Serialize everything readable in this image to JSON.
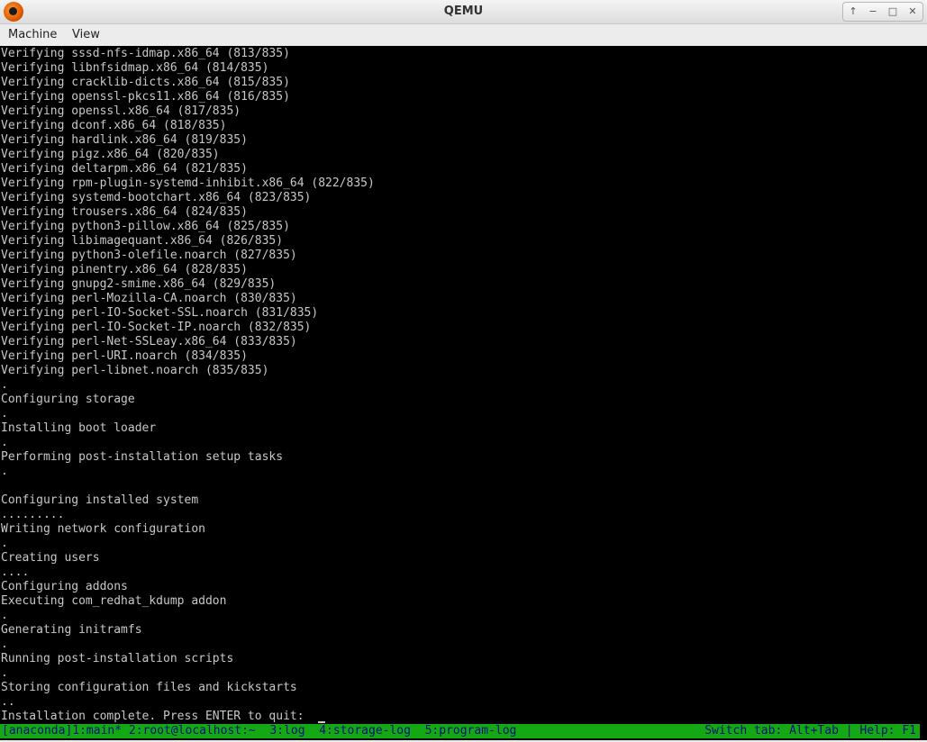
{
  "window": {
    "title": "QEMU",
    "controls": [
      "↑",
      "−",
      "□",
      "✕"
    ]
  },
  "menubar": {
    "items": [
      "Machine",
      "View"
    ]
  },
  "terminal": {
    "lines": [
      "Verifying sssd-nfs-idmap.x86_64 (813/835)",
      "Verifying libnfsidmap.x86_64 (814/835)",
      "Verifying cracklib-dicts.x86_64 (815/835)",
      "Verifying openssl-pkcs11.x86_64 (816/835)",
      "Verifying openssl.x86_64 (817/835)",
      "Verifying dconf.x86_64 (818/835)",
      "Verifying hardlink.x86_64 (819/835)",
      "Verifying pigz.x86_64 (820/835)",
      "Verifying deltarpm.x86_64 (821/835)",
      "Verifying rpm-plugin-systemd-inhibit.x86_64 (822/835)",
      "Verifying systemd-bootchart.x86_64 (823/835)",
      "Verifying trousers.x86_64 (824/835)",
      "Verifying python3-pillow.x86_64 (825/835)",
      "Verifying libimagequant.x86_64 (826/835)",
      "Verifying python3-olefile.noarch (827/835)",
      "Verifying pinentry.x86_64 (828/835)",
      "Verifying gnupg2-smime.x86_64 (829/835)",
      "Verifying perl-Mozilla-CA.noarch (830/835)",
      "Verifying perl-IO-Socket-SSL.noarch (831/835)",
      "Verifying perl-IO-Socket-IP.noarch (832/835)",
      "Verifying perl-Net-SSLeay.x86_64 (833/835)",
      "Verifying perl-URI.noarch (834/835)",
      "Verifying perl-libnet.noarch (835/835)",
      ".",
      "Configuring storage",
      ".",
      "Installing boot loader",
      ".",
      "Performing post-installation setup tasks",
      ".",
      "",
      "Configuring installed system",
      ".........",
      "Writing network configuration",
      ".",
      "Creating users",
      "....",
      "Configuring addons",
      "Executing com_redhat_kdump addon",
      ".",
      "Generating initramfs",
      ".",
      "Running post-installation scripts",
      ".",
      "Storing configuration files and kickstarts",
      "..",
      "Installation complete. Press ENTER to quit:"
    ]
  },
  "statusbar": {
    "left": "[anaconda]1:main* 2:root@localhost:~  3:log  4:storage-log  5:program-log",
    "right": "Switch tab: Alt+Tab | Help: F1"
  }
}
